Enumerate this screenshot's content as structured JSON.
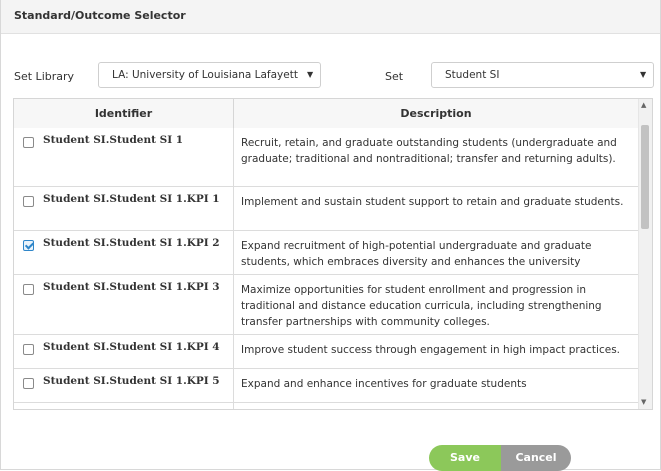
{
  "dialog": {
    "title": "Standard/Outcome Selector"
  },
  "filters": {
    "set_library_label": "Set Library",
    "set_library_value": "LA: University of Louisiana Lafayette",
    "set_label": "Set",
    "set_value": "Student SI"
  },
  "table": {
    "headers": [
      "Identifier",
      "Description"
    ],
    "rows": [
      {
        "identifier": "Student SI.Student SI 1",
        "checked": false,
        "description": "Recruit, retain, and graduate outstanding students (undergraduate and graduate; traditional and nontraditional; transfer and returning adults)."
      },
      {
        "identifier": "Student SI.Student SI 1.KPI 1",
        "checked": false,
        "description": "Implement and sustain student support to retain and graduate students."
      },
      {
        "identifier": "Student SI.Student SI 1.KPI 2",
        "checked": true,
        "description": "Expand recruitment of high-potential undergraduate and graduate students, which embraces diversity and enhances the university"
      },
      {
        "identifier": "Student SI.Student SI 1.KPI 3",
        "checked": false,
        "description": "Maximize opportunities for student enrollment and progression in traditional and distance education curricula, including strengthening transfer partnerships with community colleges."
      },
      {
        "identifier": "Student SI.Student SI 1.KPI 4",
        "checked": false,
        "description": "Improve student success through engagement in high impact practices."
      },
      {
        "identifier": "Student SI.Student SI 1.KPI 5",
        "checked": false,
        "description": "Expand and enhance incentives for graduate students"
      }
    ]
  },
  "actions": {
    "save_label": "Save",
    "cancel_label": "Cancel"
  },
  "colors": {
    "save": "#8cc85a",
    "cancel": "#9a9a9a",
    "checkbox_checked": "#2f86c9"
  }
}
